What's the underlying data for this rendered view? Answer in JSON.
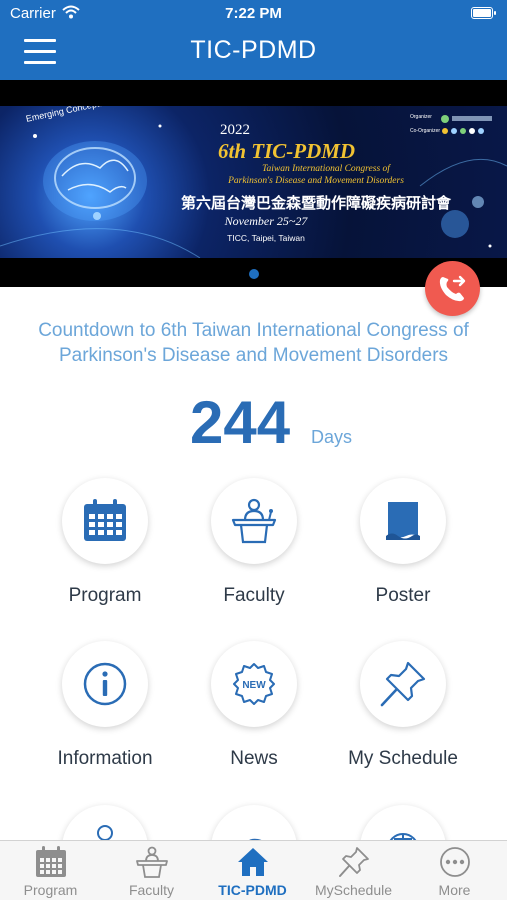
{
  "status_bar": {
    "carrier": "Carrier",
    "time": "7:22 PM"
  },
  "header": {
    "title": "TIC-PDMD",
    "menu_icon": "hamburger-menu-icon"
  },
  "banner": {
    "tagline": "Emerging Concepts and Innovating Technology",
    "year": "2022",
    "title": "6th TIC-PDMD",
    "subtitle_line1": "Taiwan International Congress of",
    "subtitle_line2": "Parkinson's Disease and Movement Disorders",
    "chinese_title": "第六屆台灣巴金森暨動作障礙疾病研討會",
    "dates": "November 25~27",
    "venue": "TICC, Taipei, Taiwan",
    "organizer_label": "Organizer",
    "co_organizer_label": "Co-Organizer"
  },
  "call_fab": {
    "icon": "phone-forward-icon",
    "color": "#f05a50"
  },
  "countdown": {
    "title": "Countdown to 6th Taiwan International Congress of Parkinson's Disease and Movement Disorders",
    "days": "244",
    "unit": "Days"
  },
  "grid": [
    {
      "label": "Program",
      "icon": "calendar-icon"
    },
    {
      "label": "Faculty",
      "icon": "podium-speaker-icon"
    },
    {
      "label": "Poster",
      "icon": "poster-icon"
    },
    {
      "label": "Information",
      "icon": "info-icon"
    },
    {
      "label": "News",
      "icon": "new-badge-icon"
    },
    {
      "label": "My Schedule",
      "icon": "pushpin-icon"
    }
  ],
  "tabbar": [
    {
      "label": "Program",
      "icon": "calendar-icon",
      "active": false
    },
    {
      "label": "Faculty",
      "icon": "podium-speaker-icon",
      "active": false
    },
    {
      "label": "TIC-PDMD",
      "icon": "home-icon",
      "active": true
    },
    {
      "label": "MySchedule",
      "icon": "pushpin-icon",
      "active": false
    },
    {
      "label": "More",
      "icon": "more-dots-icon",
      "active": false
    }
  ],
  "colors": {
    "primary": "#1f6fc0",
    "accent_light": "#6ca6d9",
    "tab_inactive": "#8e8e8e"
  }
}
